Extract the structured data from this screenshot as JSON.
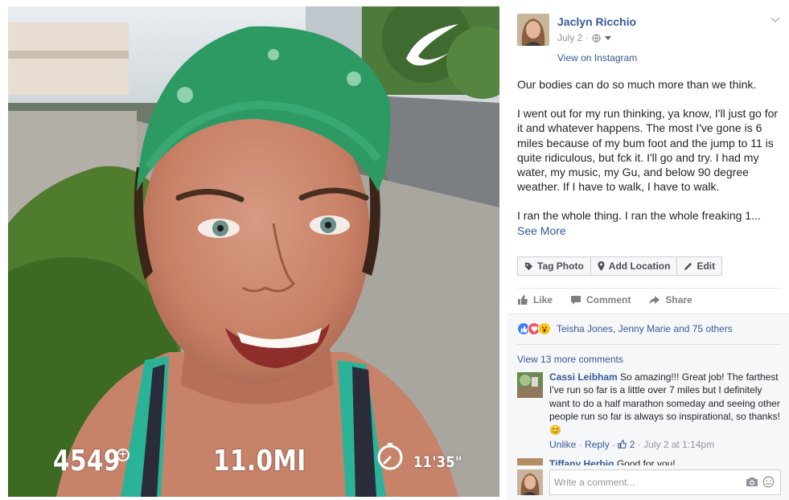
{
  "photo": {
    "stats": {
      "calories": "4549",
      "calories_plus": "+",
      "distance": "11.0MI",
      "pace": "11'35\""
    }
  },
  "post": {
    "author": "Jaclyn Ricchio",
    "date": "July 2 ·",
    "view_on_instagram": "View on Instagram",
    "body": [
      "Our bodies can do so much more than we think.",
      "I went out for my run thinking, ya know, I'll just go for it and whatever happens. The most I've gone is 6 miles because of my bum foot and the jump to 11 is quite ridiculous, but fck it. I'll go and try. I had my water, my music, my Gu, and below 90 degree weather. If I have to walk, I have to walk.",
      "I ran the whole thing. I ran the whole freaking 1..."
    ],
    "see_more": "See More",
    "photo_actions": {
      "tag_photo": "Tag Photo",
      "add_location": "Add Location",
      "edit": "Edit"
    },
    "reactions": {
      "like": "Like",
      "comment": "Comment",
      "share": "Share"
    }
  },
  "comments": {
    "likes_summary": "Teisha Jones, Jenny Marie and 75 others",
    "view_more": "View 13 more comments",
    "items": [
      {
        "author": "Cassi Leibham",
        "text": "So amazing!!! Great job! The farthest I've run so far is a little over 7 miles but I definitely want to do a half marathon someday and seeing other people run so far is always so inspirational, so thanks!",
        "emoji": "😊",
        "unlike": "Unlike",
        "reply": "Reply",
        "like_count": "2",
        "time": "July 2 at 1:14pm"
      },
      {
        "author": "Tiffany Herbig",
        "text": "Good for you!"
      }
    ],
    "composer_placeholder": "Write a comment..."
  },
  "colors": {
    "link_blue": "#365899",
    "meta_gray": "#90949c",
    "headband_green": "#2e9a63",
    "like_blue": "#4080ff",
    "love_red": "#f25268",
    "wow_yellow": "#fcc419"
  }
}
